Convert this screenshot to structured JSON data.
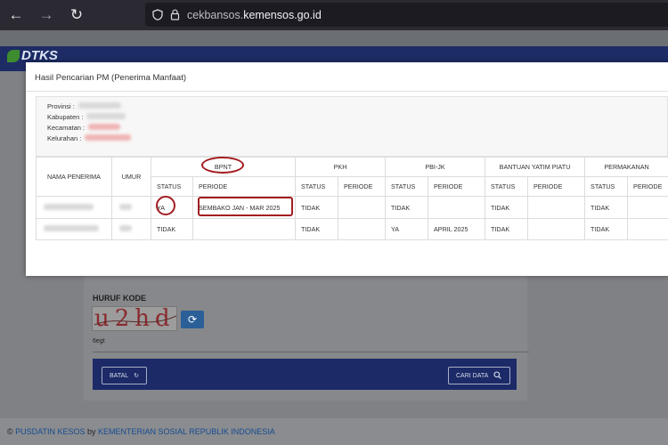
{
  "browser": {
    "url_prefix": "cekbansos.",
    "url_domain": "kemensos.go.id",
    "back_icon": "arrow-left-icon",
    "forward_icon": "arrow-right-icon",
    "reload_icon": "reload-icon"
  },
  "site": {
    "logo_text": "DTKS",
    "captcha_label": "HURUF KODE",
    "captcha_text": "u2hd",
    "captcha_input_value": "6egt",
    "batal_label": "BATAL",
    "cari_label": "CARI DATA",
    "footer_org": "PUSDATIN KESOS",
    "footer_by": " by ",
    "footer_ministry": "KEMENTERIAN SOSIAL REPUBLIK INDONESIA",
    "footer_prefix": "© "
  },
  "modal": {
    "title": "Hasil Pencarian PM (Penerima Manfaat)",
    "info": {
      "provinsi_label": "Provinsi :",
      "kabupaten_label": "Kabupaten :",
      "kecamatan_label": "Kecamatan :",
      "kelurahan_label": "Kelurahan :"
    },
    "table": {
      "col_nama": "NAMA PENERIMA",
      "col_umur": "UMUR",
      "groups": [
        "BPNT",
        "PKH",
        "PBI-JK",
        "BANTUAN YATIM PIATU",
        "PERMAKANAN"
      ],
      "sub_status": "STATUS",
      "sub_periode": "PERIODE",
      "rows": [
        {
          "bpnt_status": "YA",
          "bpnt_periode": "SEMBAKO JAN - MAR 2025",
          "pkh_status": "TIDAK",
          "pkh_periode": "",
          "pbi_status": "TIDAK",
          "pbi_periode": "",
          "yatim_status": "TIDAK",
          "yatim_periode": "",
          "makan_status": "TIDAK",
          "makan_periode": ""
        },
        {
          "bpnt_status": "TIDAK",
          "bpnt_periode": "",
          "pkh_status": "TIDAK",
          "pkh_periode": "",
          "pbi_status": "YA",
          "pbi_periode": "APRIL 2025",
          "yatim_status": "TIDAK",
          "yatim_periode": "",
          "makan_status": "TIDAK",
          "makan_periode": ""
        }
      ]
    }
  },
  "colors": {
    "header_navy": "#1e2c66",
    "annotation_red": "#a31e22",
    "link_blue": "#174b92"
  }
}
